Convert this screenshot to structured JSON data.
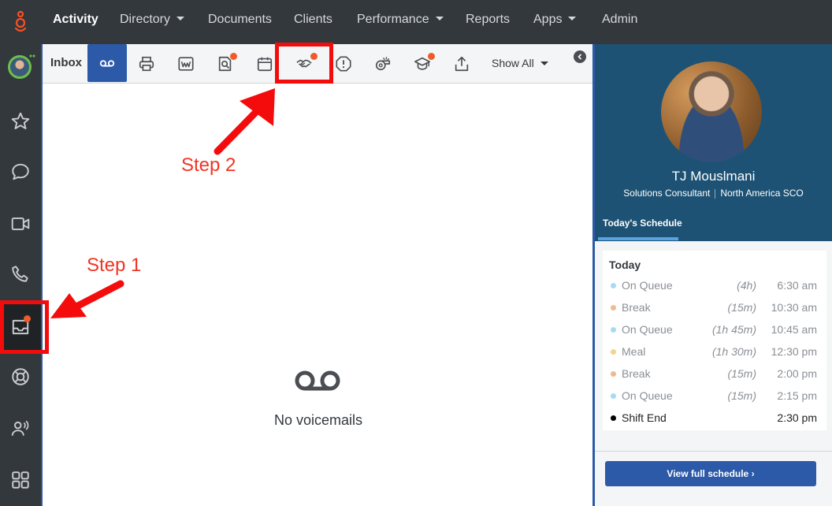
{
  "nav": {
    "items": [
      {
        "label": "Activity",
        "active": true,
        "has_caret": false
      },
      {
        "label": "Directory",
        "has_caret": true
      },
      {
        "label": "Documents",
        "has_caret": false
      },
      {
        "label": "Clients",
        "has_caret": false
      },
      {
        "label": "Performance",
        "has_caret": true
      },
      {
        "label": "Reports",
        "has_caret": false
      },
      {
        "label": "Apps",
        "has_caret": true
      },
      {
        "label": "Admin",
        "has_caret": false
      }
    ]
  },
  "sidebar": {
    "items": [
      "avatar",
      "star-icon",
      "chat-bubble-icon",
      "video-icon",
      "phone-icon",
      "inbox-icon",
      "lifebuoy-icon",
      "people-voice-icon",
      "apps-grid-icon"
    ]
  },
  "toolbar": {
    "inbox_label": "Inbox",
    "show_all_label": "Show All",
    "buttons": [
      "voicemail-icon",
      "fax-icon",
      "wem-icon",
      "quality-evaluation-icon",
      "calendar-icon",
      "handshake-icon",
      "alert-icon",
      "whistle-icon",
      "learning-cap-icon",
      "share-upload-icon"
    ]
  },
  "empty_state": {
    "message": "No voicemails"
  },
  "annotations": {
    "step1": "Step 1",
    "step2": "Step 2"
  },
  "profile": {
    "name": "TJ Mouslmani",
    "title": "Solutions Consultant",
    "division": "North America SCO",
    "tab_label": "Today's Schedule"
  },
  "schedule": {
    "heading": "Today",
    "rows": [
      {
        "activity": "On Queue",
        "duration": "(4h)",
        "time": "6:30 am",
        "color": "#a8daf5"
      },
      {
        "activity": "Break",
        "duration": "(15m)",
        "time": "10:30 am",
        "color": "#f2b98e"
      },
      {
        "activity": "On Queue",
        "duration": "(1h 45m)",
        "time": "10:45 am",
        "color": "#a8daf5"
      },
      {
        "activity": "Meal",
        "duration": "(1h 30m)",
        "time": "12:30 pm",
        "color": "#f5d48a"
      },
      {
        "activity": "Break",
        "duration": "(15m)",
        "time": "2:00 pm",
        "color": "#f2b98e"
      },
      {
        "activity": "On Queue",
        "duration": "(15m)",
        "time": "2:15 pm",
        "color": "#a8daf5"
      },
      {
        "activity": "Shift End",
        "duration": "",
        "time": "2:30 pm",
        "color": "#000000"
      }
    ],
    "button_label": "View full schedule ›"
  },
  "colors": {
    "topbar": "#33383d",
    "accent": "#2c5aa8",
    "notification": "#f15a29",
    "annotation": "#f40c0c",
    "profile_header": "#1d5274"
  }
}
